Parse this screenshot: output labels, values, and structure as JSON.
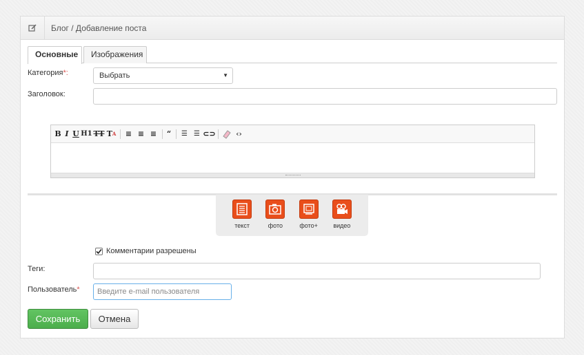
{
  "header": {
    "breadcrumb": "Блог / Добавление поста",
    "icon": "edit-icon"
  },
  "tabs": [
    {
      "label": "Основные",
      "active": true
    },
    {
      "label": "Изображения",
      "active": false
    }
  ],
  "form": {
    "category_label": "Категория",
    "category_required": "*:",
    "category_value": "Выбрать",
    "title_label": "Заголовок:",
    "title_value": "",
    "comments_checkbox_label": "Комментарии разрешены",
    "comments_checked": true,
    "tags_label": "Теги:",
    "tags_value": "",
    "user_label": "Пользователь",
    "user_required": "*",
    "user_placeholder": "Введите e-mail пользователя"
  },
  "editor": {
    "toolbar": [
      "bold",
      "italic",
      "underline",
      "heading",
      "strikethrough",
      "text-color",
      "align-left",
      "align-center",
      "align-right",
      "quote",
      "ordered-list",
      "unordered-list",
      "link",
      "eraser",
      "source-code"
    ]
  },
  "blocks": [
    {
      "label": "текст",
      "icon": "text-block-icon"
    },
    {
      "label": "фото",
      "icon": "camera-icon"
    },
    {
      "label": "фото+",
      "icon": "gallery-icon"
    },
    {
      "label": "видео",
      "icon": "video-camera-icon"
    }
  ],
  "buttons": {
    "save": "Сохранить",
    "cancel": "Отмена"
  },
  "colors": {
    "save_green": "#4cae4c",
    "block_orange": "#e94e1b",
    "required_red": "#d9534f"
  }
}
